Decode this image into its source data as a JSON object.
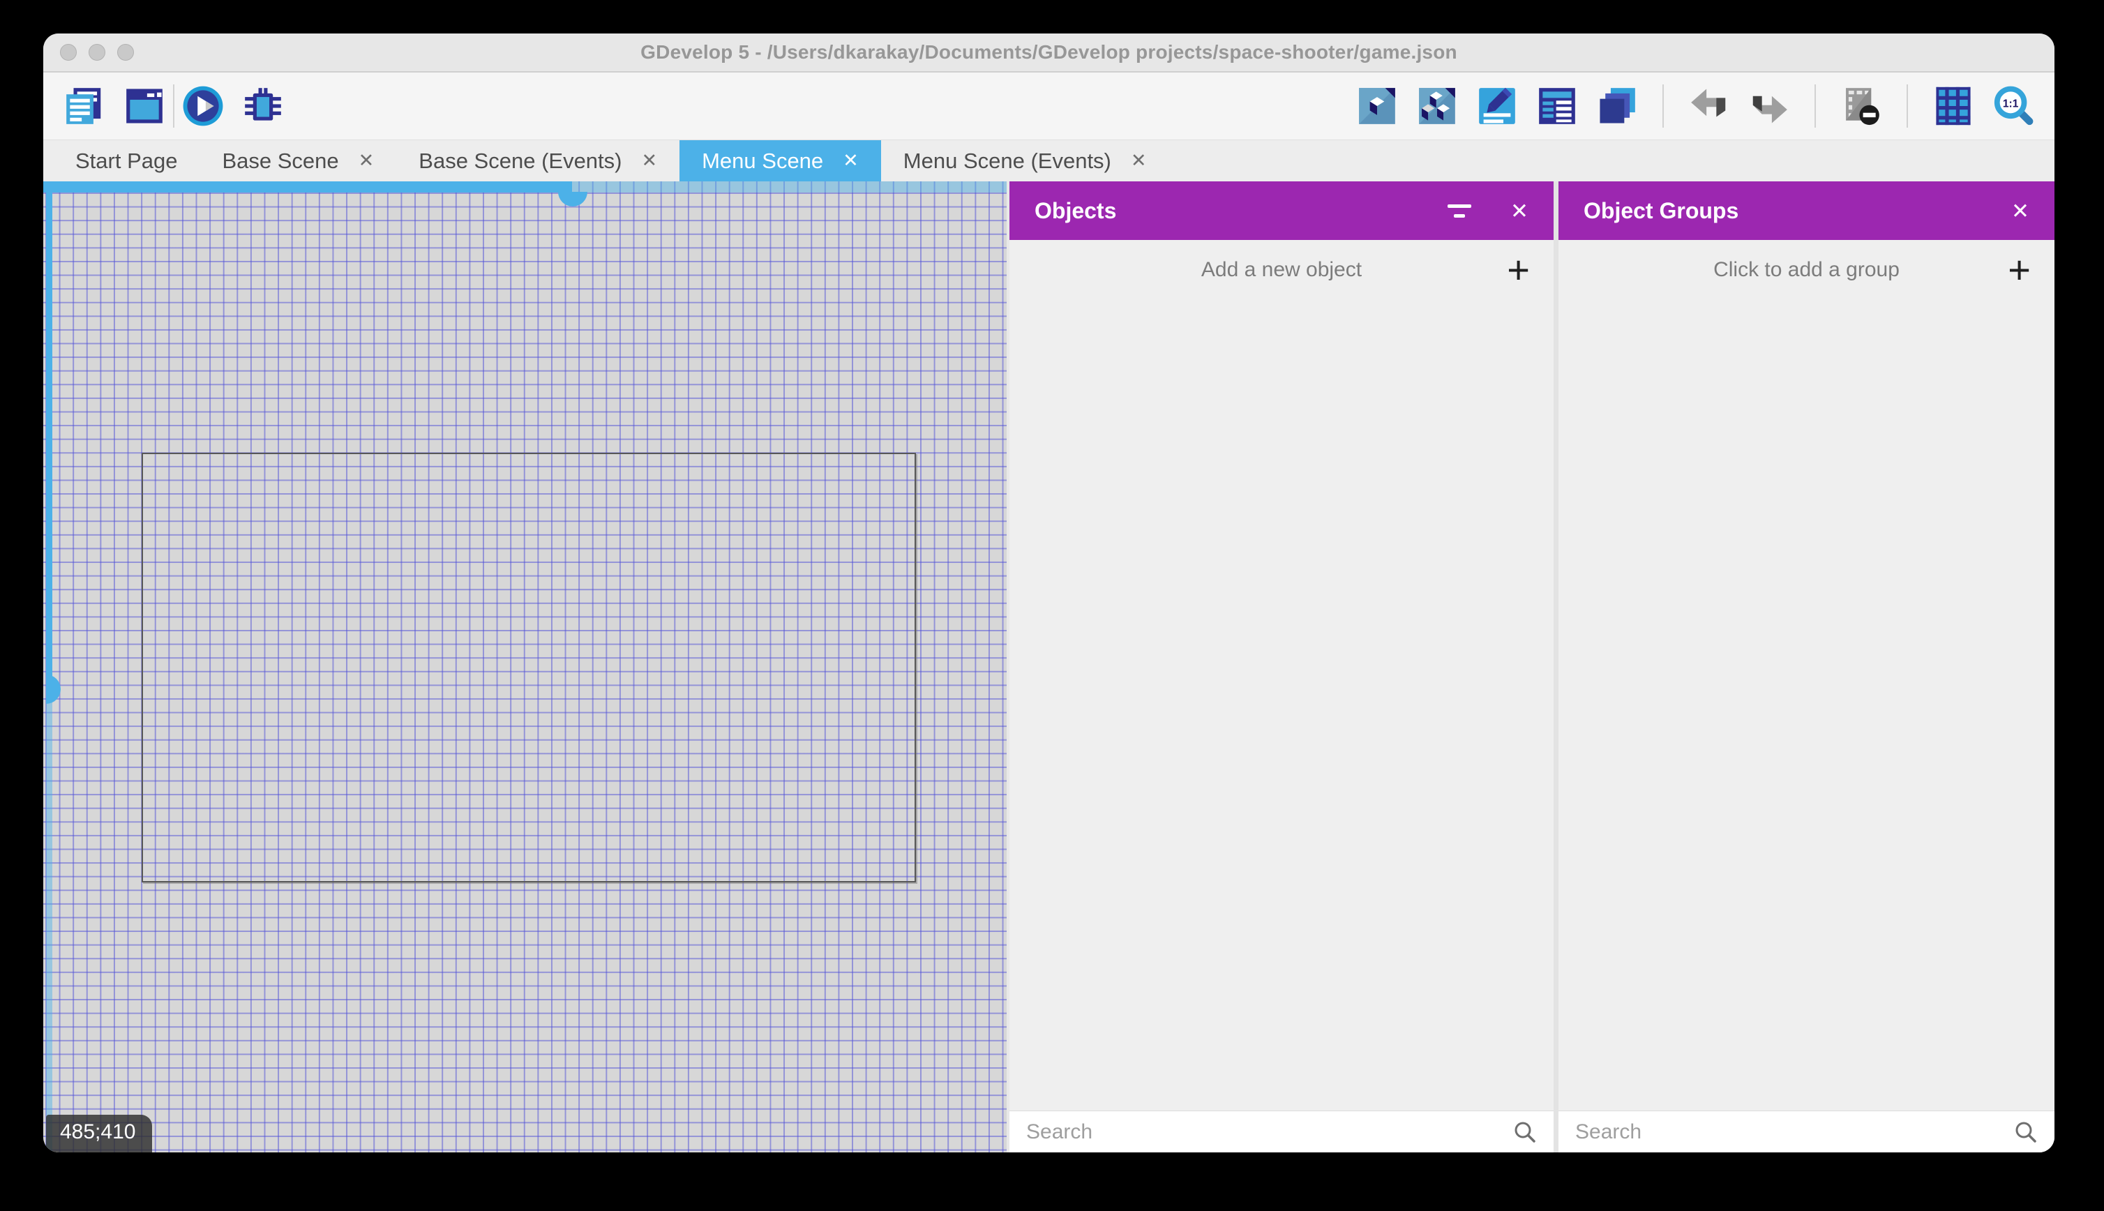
{
  "window": {
    "title": "GDevelop 5 - /Users/dkarakay/Documents/GDevelop projects/space-shooter/game.json"
  },
  "toolbar": {
    "left_icons": [
      "project-manager-icon",
      "open-scene-icon",
      "play-icon",
      "debug-icon"
    ],
    "right_icons": [
      "objects-editor-icon",
      "object-groups-editor-icon",
      "properties-icon",
      "instances-list-icon",
      "layers-icon",
      "undo-icon",
      "redo-icon",
      "window-mask-icon",
      "grid-icon",
      "zoom-original-icon"
    ],
    "zoom_label": "1:1"
  },
  "tabs": [
    {
      "label": "Start Page",
      "closable": false,
      "active": false
    },
    {
      "label": "Base Scene",
      "closable": true,
      "active": false
    },
    {
      "label": "Base Scene (Events)",
      "closable": true,
      "active": false
    },
    {
      "label": "Menu Scene",
      "closable": true,
      "active": true
    },
    {
      "label": "Menu Scene (Events)",
      "closable": true,
      "active": false
    }
  ],
  "canvas": {
    "coordinates": "485;410"
  },
  "panels": {
    "objects": {
      "title": "Objects",
      "add_label": "Add a new object",
      "search_placeholder": "Search"
    },
    "groups": {
      "title": "Object Groups",
      "add_label": "Click to add a group",
      "search_placeholder": "Search"
    }
  },
  "ui": {
    "close_glyph": "✕",
    "plus_glyph": "+"
  },
  "colors": {
    "accent_purple": "#9c27b0",
    "accent_blue": "#4cb1e8",
    "grid_line_blue": "#6e6edd",
    "icon_blue": "#3fa9dc",
    "icon_navy": "#2e3192"
  }
}
